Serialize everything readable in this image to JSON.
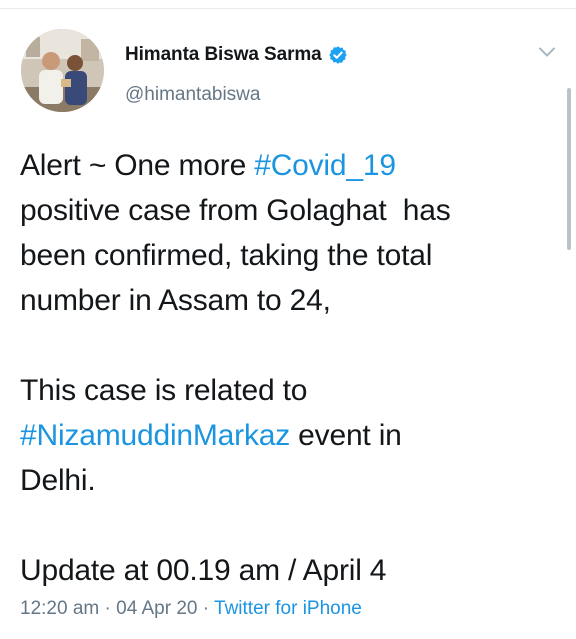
{
  "user": {
    "display_name": "Himanta Biswa Sarma",
    "handle": "@himantabiswa",
    "verified": true
  },
  "tweet": {
    "line1_prefix": "Alert ~ One more ",
    "hashtag1": "#Covid_19",
    "line2": "positive case from Golaghat  has",
    "line3": "been confirmed, taking the total",
    "line4": "number in Assam to 24,",
    "line5": "This case is related to",
    "hashtag2": "#NizamuddinMarkaz",
    "line6_suffix": " event in",
    "line7": "Delhi.",
    "line8": "Update at 00.19 am / April 4"
  },
  "meta": {
    "time": "12:20 am",
    "date": "04 Apr 20",
    "separator": "·",
    "source": "Twitter for iPhone"
  },
  "colors": {
    "link": "#1b95e0",
    "secondary_text": "#657786",
    "primary_text": "#14171a",
    "verified_badge": "#1da1f2"
  },
  "icons": {
    "verified": "verified-badge-icon",
    "menu": "chevron-down-icon"
  }
}
